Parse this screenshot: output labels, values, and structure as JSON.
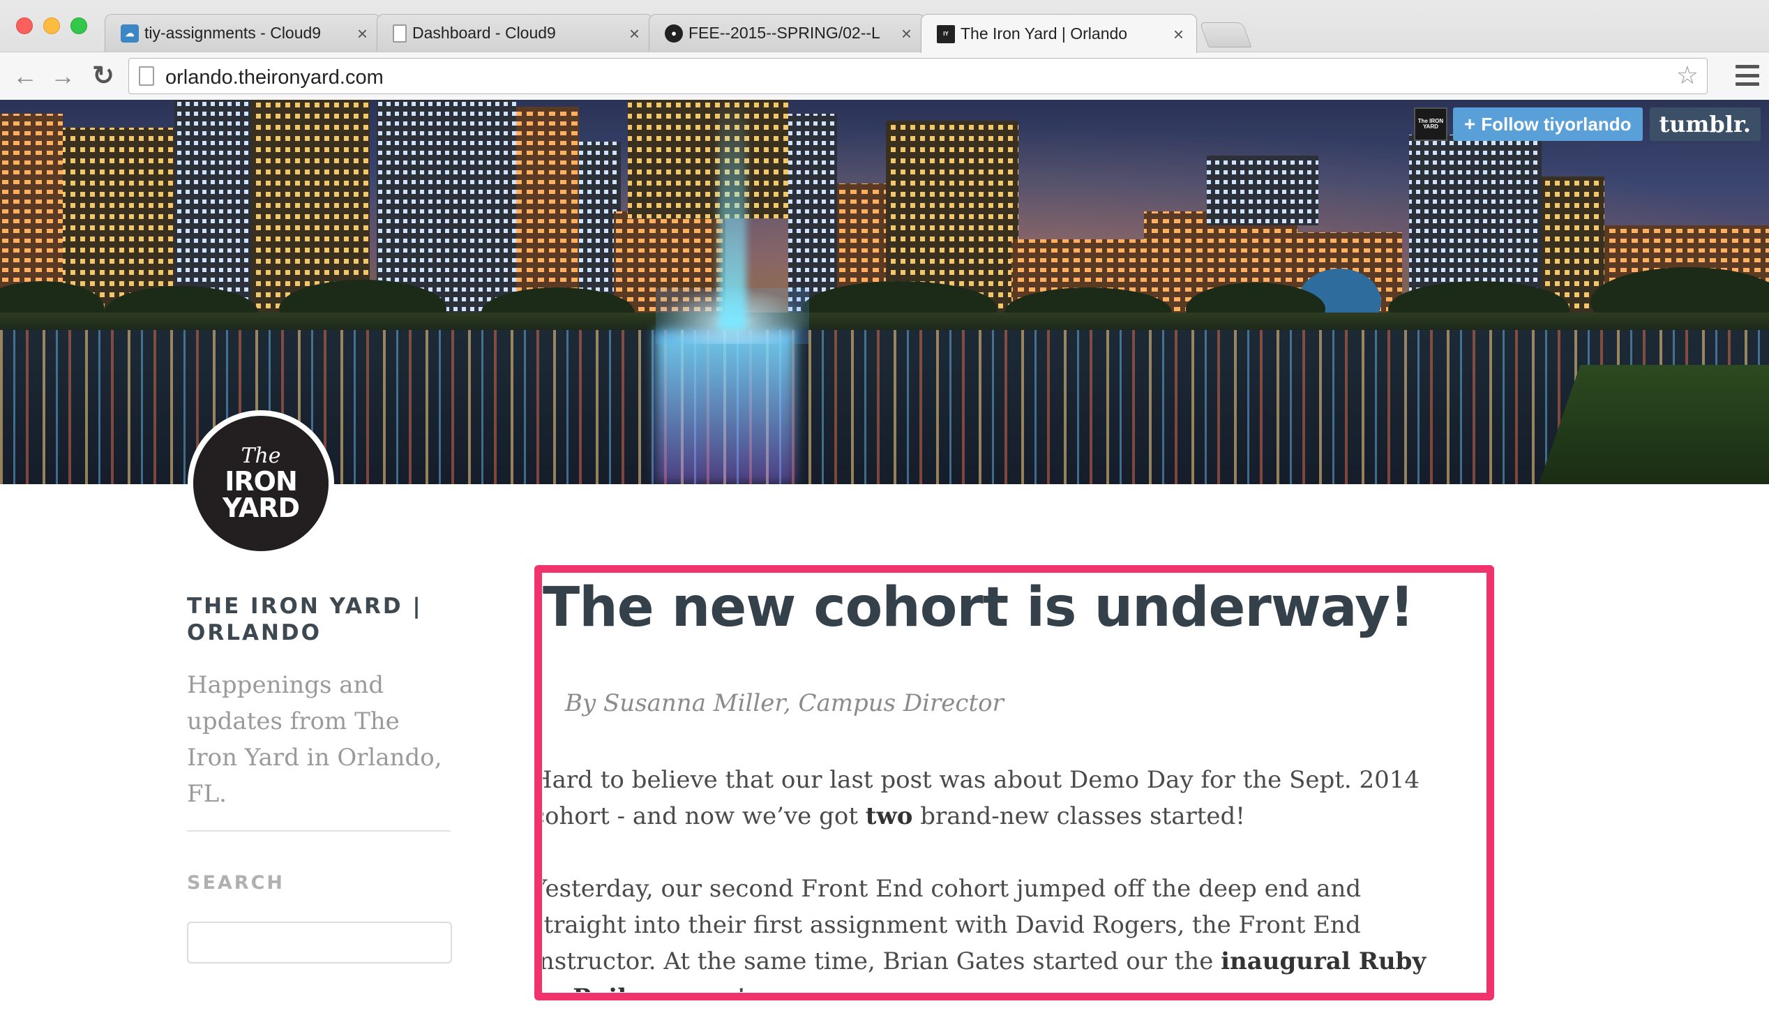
{
  "browser": {
    "tabs": [
      {
        "title": "tiy-assignments - Cloud9",
        "icon": "cloud9-icon",
        "active": false
      },
      {
        "title": "Dashboard - Cloud9",
        "icon": "page-icon",
        "active": false
      },
      {
        "title": "FEE--2015--SPRING/02--L",
        "icon": "github-icon",
        "active": false
      },
      {
        "title": "The Iron Yard | Orlando",
        "icon": "iron-yard-icon",
        "active": true
      }
    ],
    "url": "orlando.theironyard.com",
    "close_glyph": "×"
  },
  "banner": {
    "follow_label": "Follow tiyorlando",
    "follow_plus": "+",
    "tumblr_label": "tumblr.",
    "avatar_text": "The IRON YARD"
  },
  "logo": {
    "line1": "The",
    "line2": "IRON",
    "line3": "YARD"
  },
  "sidebar": {
    "title": "THE IRON YARD | ORLANDO",
    "description": "Happenings and updates from The Iron Yard in Orlando, FL.",
    "search_label": "SEARCH",
    "search_value": ""
  },
  "post": {
    "title": "The new cohort is underway!",
    "byline": "By Susanna Miller, Campus Director",
    "p1_a": "Hard to believe that our last post was about Demo Day for the Sept. 2014 cohort - and now we’ve got ",
    "p1_bold": "two",
    "p1_b": " brand-new classes started!",
    "p2_a": "Yesterday, our second Front End cohort jumped off the deep end and straight into their first assignment with David Rogers, the Front End instructor. At the same time, Brian Gates started our the ",
    "p2_bold": "inaugural Ruby on Rails course",
    "p2_b": "!"
  },
  "colors": {
    "highlight_frame": "#f1336c",
    "follow_button": "#5aa0d8",
    "tumblr_badge": "#3b4f67",
    "title_text": "#34414a"
  }
}
